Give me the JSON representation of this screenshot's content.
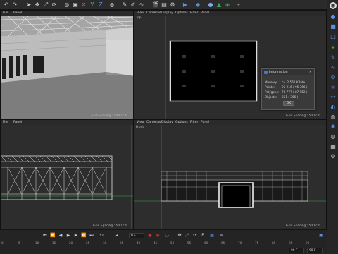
{
  "toolbar": {
    "icons": [
      "arrow-undo-icon",
      "arrow-redo-icon",
      "cursor-icon",
      "move-icon",
      "scale-icon",
      "rotate-icon",
      "live-selection-icon",
      "object-icon",
      "x-axis-icon",
      "y-axis-icon",
      "z-axis-icon",
      "world-icon",
      "pen-icon",
      "brush-icon",
      "spline-icon",
      "clapper-icon",
      "film-icon",
      "render-settings-icon",
      "render-icon",
      "cube-icon",
      "sphere-icon",
      "cloud-icon",
      "tag-icon",
      "settings-icon"
    ]
  },
  "right_toolbar": {
    "icons": [
      "avatar",
      "sphere-icon",
      "cube-icon",
      "square-icon",
      "wand-icon",
      "pen-icon",
      "spline-icon",
      "gear-icon",
      "lines-icon",
      "link-icon",
      "nurbs-icon",
      "tag-icon",
      "light-icon",
      "globe-icon",
      "grid-icon",
      "settings-icon"
    ]
  },
  "viewports": {
    "perspective": {
      "menu": [
        "File",
        "Panel"
      ],
      "grid_label": "Grid Spacing : 5000 cm",
      "camera_label": "Cam Perc..."
    },
    "top": {
      "menu": [
        "View",
        "Cameras",
        "Display",
        "Options",
        "Filter",
        "Panel"
      ],
      "name": "Top",
      "grid_label": "Grid Spacing : 500 cm"
    },
    "right": {
      "menu": [
        "File",
        "Panel"
      ],
      "grid_label": "Grid Spacing : 500 cm"
    },
    "front": {
      "menu": [
        "View",
        "Cameras",
        "Display",
        "Options",
        "Filter",
        "Panel"
      ],
      "name": "Front",
      "grid_label": "Grid Spacing : 500 cm"
    }
  },
  "info_dialog": {
    "title": "Information",
    "rows": [
      {
        "label": "Memory:",
        "value": "ca. 2 561 KByte"
      },
      {
        "label": "Points:",
        "value": "95 216 ( 95 366 )"
      },
      {
        "label": "Polygons:",
        "value": "78 777 ( 87 952 )"
      },
      {
        "label": "Objects:",
        "value": "351 ( 366 )"
      }
    ],
    "ok_label": "OK"
  },
  "timeline": {
    "frame_value": "0 F",
    "end_value_1": "90 F",
    "end_value_2": "90 F",
    "ruler": [
      "0",
      "5",
      "10",
      "15",
      "20",
      "25",
      "30",
      "35",
      "40",
      "45",
      "50",
      "55",
      "60",
      "65",
      "70",
      "75",
      "80",
      "85",
      "90"
    ]
  },
  "colors": {
    "accent_blue": "#3d7bd6",
    "record_red": "#d0342c",
    "axis_green": "#3aa84a",
    "viewport_bg": "#2d2d2d"
  }
}
